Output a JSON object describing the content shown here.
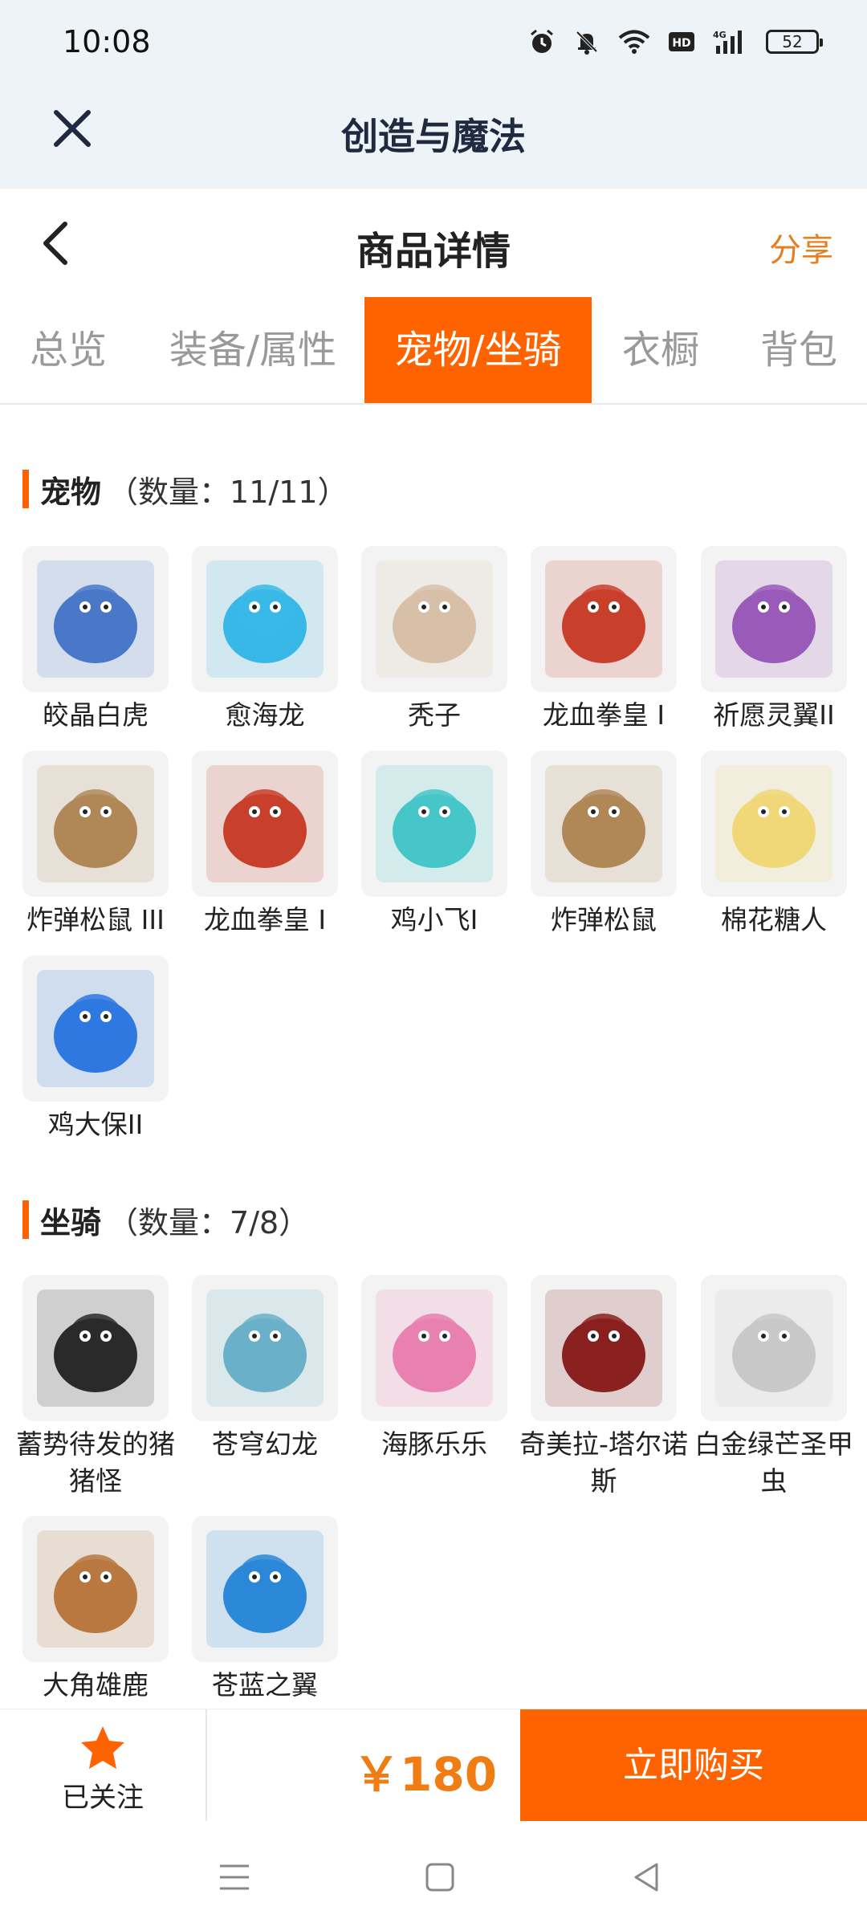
{
  "status_bar": {
    "time": "10:08",
    "battery": "52"
  },
  "app_bar": {
    "title": "创造与魔法"
  },
  "header": {
    "title": "商品详情",
    "share": "分享"
  },
  "tabs": [
    {
      "label": "总览"
    },
    {
      "label": "装备/属性"
    },
    {
      "label": "宠物/坐骑"
    },
    {
      "label": "衣橱"
    },
    {
      "label": "背包"
    }
  ],
  "active_tab": 2,
  "pets": {
    "title": "宠物",
    "count": "（数量：11/11）",
    "items": [
      {
        "name": "皎晶白虎",
        "icon": "white-tiger-icon",
        "color": "#4a78c8"
      },
      {
        "name": "愈海龙",
        "icon": "sea-dragon-icon",
        "color": "#38b8e6"
      },
      {
        "name": "秃子",
        "icon": "bald-character-icon",
        "color": "#d8c0a8"
      },
      {
        "name": "龙血拳皇 I",
        "icon": "dragon-blood-boxer-icon",
        "color": "#c8402c"
      },
      {
        "name": "祈愿灵翼II",
        "icon": "wish-wing-bird-icon",
        "color": "#9a5ab8"
      },
      {
        "name": "炸弹松鼠 III",
        "icon": "bomb-squirrel-icon",
        "color": "#b08858"
      },
      {
        "name": "龙血拳皇 I",
        "icon": "dragon-blood-boxer-icon",
        "color": "#c8402c"
      },
      {
        "name": "鸡小飞I",
        "icon": "chicken-flyer-icon",
        "color": "#46c6c8"
      },
      {
        "name": "炸弹松鼠",
        "icon": "bomb-squirrel-icon",
        "color": "#b08858"
      },
      {
        "name": "棉花糖人",
        "icon": "marshmallow-man-icon",
        "color": "#f0d878"
      },
      {
        "name": "鸡大保II",
        "icon": "chicken-boss-icon",
        "color": "#2e78e0"
      }
    ]
  },
  "mounts": {
    "title": "坐骑",
    "count": "（数量：7/8）",
    "items": [
      {
        "name": "蓄势待发的猪猪怪",
        "icon": "pig-monster-icon",
        "color": "#2a2a2a"
      },
      {
        "name": "苍穹幻龙",
        "icon": "sky-dragon-icon",
        "color": "#6ab0c8"
      },
      {
        "name": "海豚乐乐",
        "icon": "dolphin-icon",
        "color": "#e880b0"
      },
      {
        "name": "奇美拉-塔尔诺斯",
        "icon": "chimera-icon",
        "color": "#8a2020"
      },
      {
        "name": "白金绿芒圣甲虫",
        "icon": "scarab-beetle-icon",
        "color": "#c8c8c8"
      },
      {
        "name": "大角雄鹿",
        "icon": "antler-deer-icon",
        "color": "#b87840"
      },
      {
        "name": "苍蓝之翼",
        "icon": "azure-wing-icon",
        "color": "#2c88d8"
      }
    ]
  },
  "bottom_bar": {
    "follow_label": "已关注",
    "price": "￥180",
    "buy_label": "立即购买"
  },
  "colors": {
    "accent": "#ff6300",
    "price": "#f07c14",
    "share": "#e67e22"
  }
}
